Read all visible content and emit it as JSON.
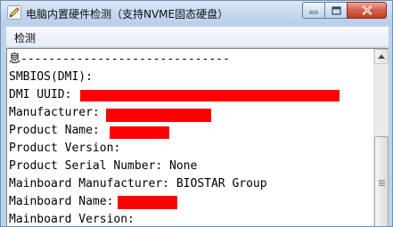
{
  "window": {
    "title": "电脑内置硬件检测（支持NVME固态硬盘）"
  },
  "menu": {
    "items": [
      "检测"
    ]
  },
  "output": {
    "lines": [
      "息------------------------------",
      "SMBIOS(DMI):",
      "DMI UUID:",
      "Manufacturer:",
      "Product Name:",
      "Product Version:",
      "Product Serial Number: None",
      "Mainboard Manufacturer: BIOSTAR Group",
      "Mainboard Name:",
      "Mainboard Version:"
    ]
  },
  "colors": {
    "redaction": "#ff0000",
    "title_bar": "#c4d8ee",
    "close_button": "#c23e26"
  },
  "icons": {
    "app": "pencil-icon",
    "minimize": "minimize-icon",
    "maximize": "maximize-icon",
    "close": "close-icon",
    "scroll_up": "scroll-up-arrow-icon"
  }
}
